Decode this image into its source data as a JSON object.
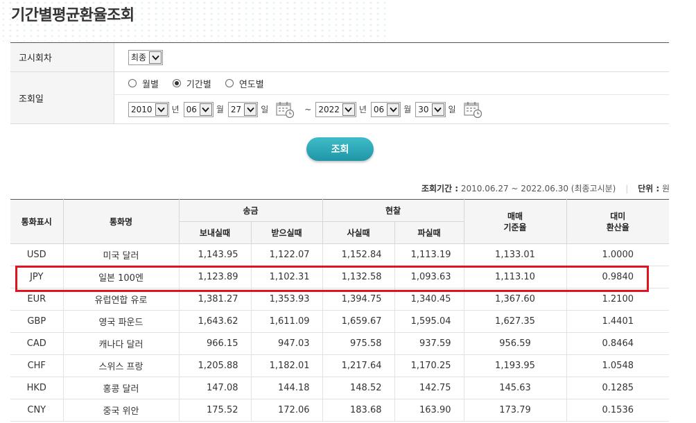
{
  "page": {
    "title": "기간별평균환율조회"
  },
  "form": {
    "notice_label": "고시회차",
    "notice_value": "최종",
    "date_label": "조회일",
    "radios": [
      {
        "label": "월별",
        "checked": false
      },
      {
        "label": "기간별",
        "checked": true
      },
      {
        "label": "연도별",
        "checked": false
      }
    ],
    "start": {
      "year": "2010",
      "month": "06",
      "day": "27"
    },
    "end": {
      "year": "2022",
      "month": "06",
      "day": "30"
    },
    "units": {
      "year": "년",
      "month": "월",
      "day": "일"
    },
    "tilde": "~"
  },
  "search_button": "조회",
  "period": {
    "label": "조회기간 :",
    "value": "2010.06.27 ~ 2022.06.30 (최종고시분)",
    "unit_label": "단위 :",
    "unit_value": "원"
  },
  "table": {
    "headers": {
      "code": "통화표시",
      "name": "통화명",
      "remit": "송금",
      "cash": "현찰",
      "base": "매매\n기준율",
      "usd": "대미\n환산율",
      "send": "보내실때",
      "receive": "받으실때",
      "buy": "사실때",
      "sell": "파실때"
    },
    "rows": [
      {
        "code": "USD",
        "name": "미국 달러",
        "send": "1,143.95",
        "receive": "1,122.07",
        "buy": "1,152.84",
        "sell": "1,113.19",
        "base": "1,133.01",
        "usd": "1.0000"
      },
      {
        "code": "JPY",
        "name": "일본 100엔",
        "send": "1,123.89",
        "receive": "1,102.31",
        "buy": "1,132.58",
        "sell": "1,093.63",
        "base": "1,113.10",
        "usd": "0.9840"
      },
      {
        "code": "EUR",
        "name": "유럽연합 유로",
        "send": "1,381.27",
        "receive": "1,353.93",
        "buy": "1,394.75",
        "sell": "1,340.45",
        "base": "1,367.60",
        "usd": "1.2100"
      },
      {
        "code": "GBP",
        "name": "영국 파운드",
        "send": "1,643.62",
        "receive": "1,611.09",
        "buy": "1,659.67",
        "sell": "1,595.04",
        "base": "1,627.35",
        "usd": "1.4401"
      },
      {
        "code": "CAD",
        "name": "캐나다 달러",
        "send": "966.15",
        "receive": "947.03",
        "buy": "975.58",
        "sell": "937.59",
        "base": "956.59",
        "usd": "0.8464"
      },
      {
        "code": "CHF",
        "name": "스위스 프랑",
        "send": "1,205.88",
        "receive": "1,182.01",
        "buy": "1,217.64",
        "sell": "1,170.25",
        "base": "1,193.95",
        "usd": "1.0548"
      },
      {
        "code": "HKD",
        "name": "홍콩 달러",
        "send": "147.08",
        "receive": "144.18",
        "buy": "148.52",
        "sell": "142.75",
        "base": "145.63",
        "usd": "0.1285"
      },
      {
        "code": "CNY",
        "name": "중국 위안",
        "send": "175.52",
        "receive": "172.06",
        "buy": "183.68",
        "sell": "163.90",
        "base": "173.79",
        "usd": "0.1536"
      }
    ],
    "highlighted_row": "JPY",
    "highlight_color": "#e0141e"
  },
  "icons": {
    "calendar": "calendar-icon",
    "dropdown": "chevron-down-icon"
  },
  "colors": {
    "button": "#2aa9b8",
    "highlight": "#e0141e"
  }
}
